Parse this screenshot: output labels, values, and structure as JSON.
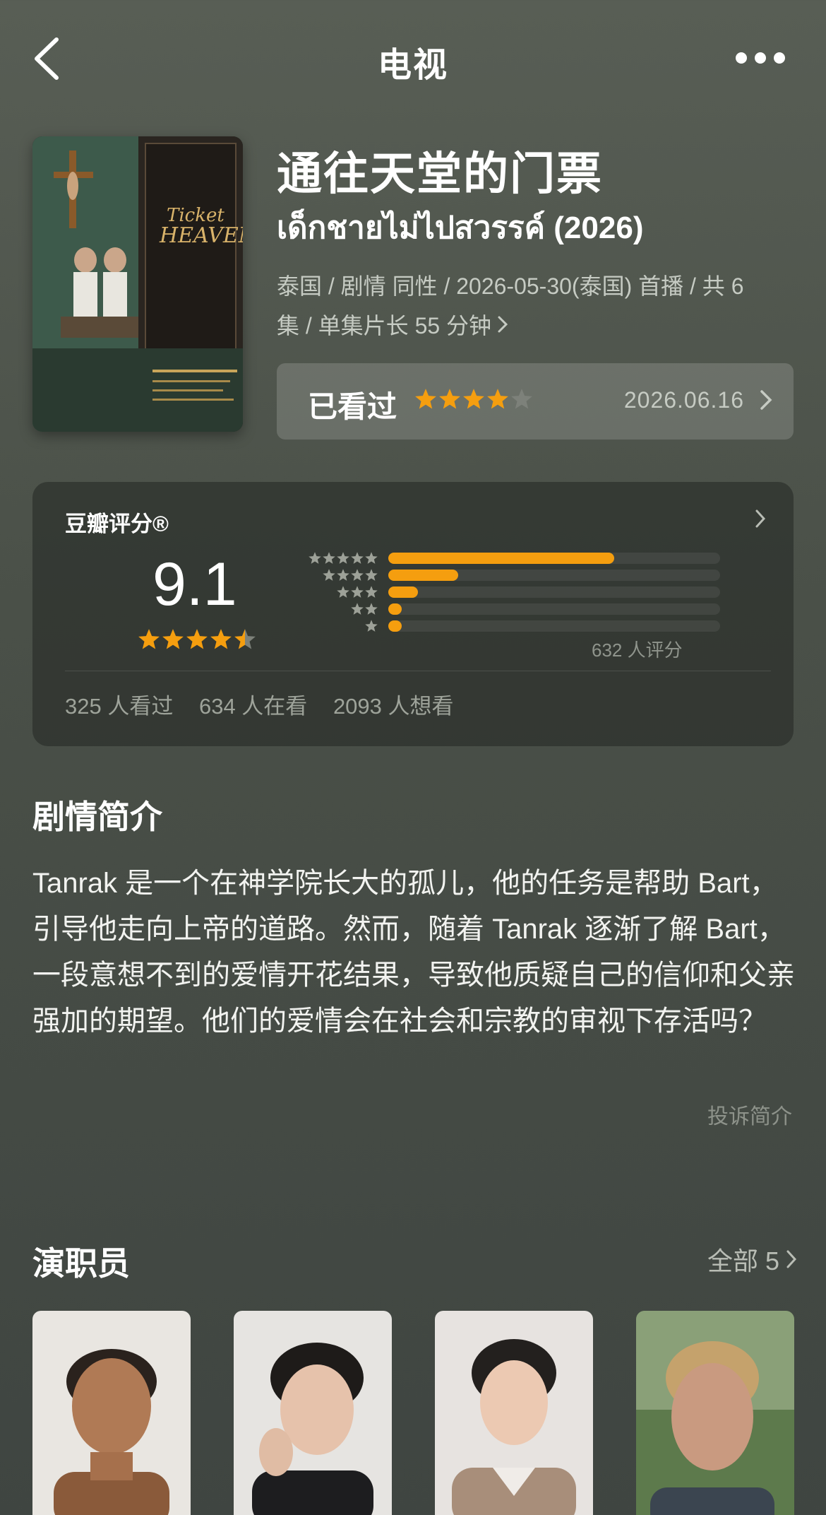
{
  "nav": {
    "title": "电视"
  },
  "show": {
    "title": "通往天堂的门票",
    "original_title": "เด็กชายไม่ไปสวรรค์ (2026)",
    "meta_line1": "泰国 / 剧情 同性 / 2026-05-30(泰国) 首播 / 共 6",
    "meta_line2": "集 / 单集片长 55 分钟",
    "poster_alt_text": "Ticket to Heaven"
  },
  "watched": {
    "label": "已看过",
    "rating": 4,
    "max": 5,
    "date": "2026.06.16"
  },
  "rating": {
    "brand": "豆瓣评分®",
    "score": "9.1",
    "score_stars": 4.5,
    "distribution": [
      {
        "stars": 5,
        "fraction": 0.68
      },
      {
        "stars": 4,
        "fraction": 0.21
      },
      {
        "stars": 3,
        "fraction": 0.09
      },
      {
        "stars": 2,
        "fraction": 0.04
      },
      {
        "stars": 1,
        "fraction": 0.04
      }
    ],
    "count_text": "632 人评分",
    "watched_text": "325 人看过",
    "watching_text": "634 人在看",
    "want_text": "2093 人想看"
  },
  "synopsis": {
    "title": "剧情简介",
    "text": "Tanrak 是一个在神学院长大的孤儿，他的任务是帮助 Bart，引导他走向上帝的道路。然而，随着 Tanrak 逐渐了解 Bart，一段意想不到的爱情开花结果，导致他质疑自己的信仰和父亲强加的期望。他们的爱情会在社会和宗教的审视下存活吗？",
    "report": "投诉简介"
  },
  "cast": {
    "title": "演职员",
    "all_label": "全部 5"
  },
  "colors": {
    "accent_star": "#f59e0f",
    "empty_star": "#7d817a"
  }
}
